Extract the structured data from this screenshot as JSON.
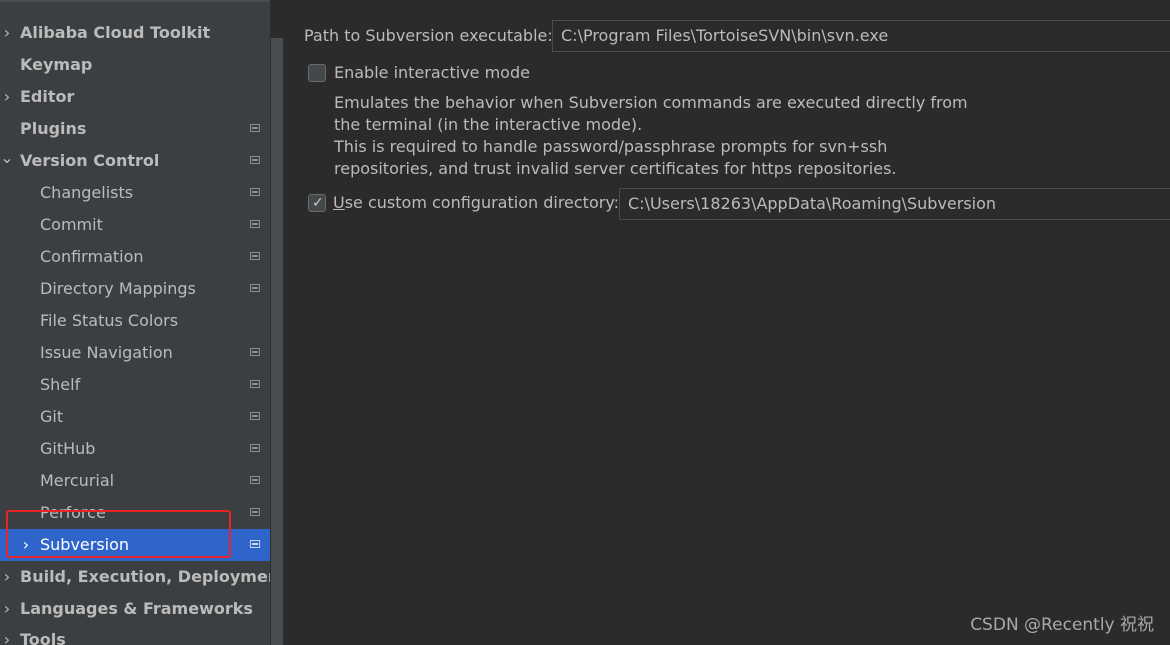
{
  "sidebar": {
    "items": [
      {
        "label": "Alibaba Cloud Toolkit",
        "arrow": "›"
      },
      {
        "label": "Keymap"
      },
      {
        "label": "Editor",
        "arrow": "›"
      },
      {
        "label": "Plugins"
      },
      {
        "label": "Version Control",
        "arrow": "⌄"
      },
      {
        "label": "Changelists"
      },
      {
        "label": "Commit"
      },
      {
        "label": "Confirmation"
      },
      {
        "label": "Directory Mappings"
      },
      {
        "label": "File Status Colors"
      },
      {
        "label": "Issue Navigation"
      },
      {
        "label": "Shelf"
      },
      {
        "label": "Git"
      },
      {
        "label": "GitHub"
      },
      {
        "label": "Mercurial"
      },
      {
        "label": "Perforce"
      },
      {
        "label": "Subversion",
        "arrow": "›"
      },
      {
        "label": "Build, Execution, Deployment",
        "arrow": "›"
      },
      {
        "label": "Languages & Frameworks",
        "arrow": "›"
      },
      {
        "label": "Tools",
        "arrow": "›"
      }
    ]
  },
  "settings": {
    "path_label": "Path to Subversion executable:",
    "path_value": "C:\\Program Files\\TortoiseSVN\\bin\\svn.exe",
    "interactive_label": "Enable interactive mode",
    "interactive_checked": false,
    "description": [
      "Emulates the behavior when Subversion commands are executed directly from",
      "the terminal (in the interactive mode).",
      "This is required to handle password/passphrase prompts for svn+ssh",
      "repositories, and trust invalid server certificates for https repositories."
    ],
    "config_dir_label": "Use custom configuration directory:",
    "config_dir_checked": true,
    "config_dir_value": "C:\\Users\\18263\\AppData\\Roaming\\Subversion"
  },
  "watermark": "CSDN @Recently 祝祝",
  "colors": {
    "selection": "#2f65ca",
    "highlight_box": "#e8262a"
  }
}
